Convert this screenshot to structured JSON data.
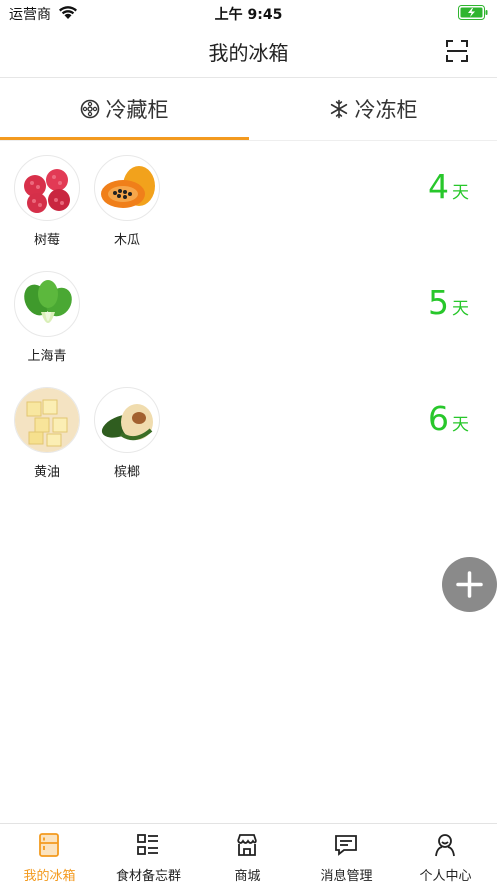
{
  "status_bar": {
    "carrier": "运营商",
    "time": "上午 9:45"
  },
  "header": {
    "title": "我的冰箱"
  },
  "tabs": [
    {
      "label": "冷藏柜",
      "icon": "fridge-compartment-icon",
      "active": true
    },
    {
      "label": "冷冻柜",
      "icon": "snowflake-icon",
      "active": false
    }
  ],
  "groups": [
    {
      "days": "4",
      "unit": "天",
      "items": [
        {
          "name": "树莓",
          "icon": "raspberry-image"
        },
        {
          "name": "木瓜",
          "icon": "papaya-image"
        }
      ]
    },
    {
      "days": "5",
      "unit": "天",
      "items": [
        {
          "name": "上海青",
          "icon": "bok-choy-image"
        }
      ]
    },
    {
      "days": "6",
      "unit": "天",
      "items": [
        {
          "name": "黄油",
          "icon": "butter-image"
        },
        {
          "name": "槟榔",
          "icon": "betel-nut-image"
        }
      ]
    }
  ],
  "tab_bar": [
    {
      "label": "我的冰箱",
      "icon": "fridge-icon",
      "active": true
    },
    {
      "label": "食材备忘群",
      "icon": "list-icon",
      "active": false
    },
    {
      "label": "商城",
      "icon": "store-icon",
      "active": false
    },
    {
      "label": "消息管理",
      "icon": "message-icon",
      "active": false
    },
    {
      "label": "个人中心",
      "icon": "user-icon",
      "active": false
    }
  ],
  "colors": {
    "accent": "#f39a1f",
    "days": "#28c72b",
    "fab": "#8a8a8a"
  }
}
